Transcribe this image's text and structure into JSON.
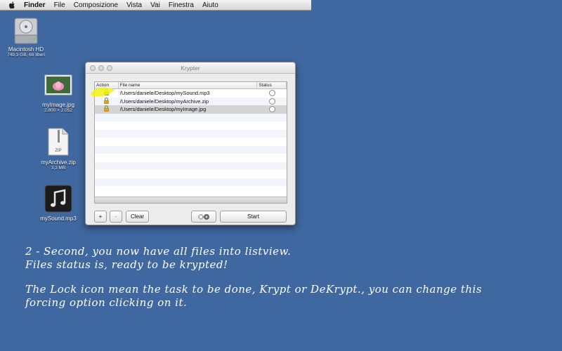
{
  "menubar": {
    "apple_icon": "apple-logo",
    "items": [
      "Finder",
      "File",
      "Composizione",
      "Vista",
      "Vai",
      "Finestra",
      "Aiuto"
    ]
  },
  "desktop": {
    "hd": {
      "name": "Macintosh HD",
      "info": "749,3 GB, 68 liberi"
    },
    "image": {
      "name": "myImage.jpg",
      "info": "2.800 × 2.052"
    },
    "archive": {
      "name": "myArchive.zip",
      "info": "3,3 MB",
      "badge": "ZIP"
    },
    "sound": {
      "name": "mySound.mp3"
    }
  },
  "window": {
    "title": "Krypter",
    "columns": {
      "action": "Action",
      "file": "File name",
      "status": "Status"
    },
    "rows": [
      {
        "path": "/Users/daniele/Desktop/mySound.mp3",
        "action_icon": "lock-icon"
      },
      {
        "path": "/Users/daniele/Desktop/myArchive.zip",
        "action_icon": "lock-icon"
      },
      {
        "path": "/Users/daniele/Desktop/myImage.jpg",
        "action_icon": "lock-icon"
      }
    ],
    "buttons": {
      "add": "+",
      "remove": "-",
      "clear": "Clear",
      "start": "Start"
    },
    "colors": {
      "highlight": "#f2f20e",
      "lock": "#e0a818"
    }
  },
  "instructions": {
    "line1": "2 - Second, you now have all files into listview.",
    "line2": "Files status is, ready to be krypted!",
    "line3": "The Lock icon mean the task to be done, Krypt or DeKrypt., you can change this",
    "line4": "forcing option clicking on it."
  }
}
